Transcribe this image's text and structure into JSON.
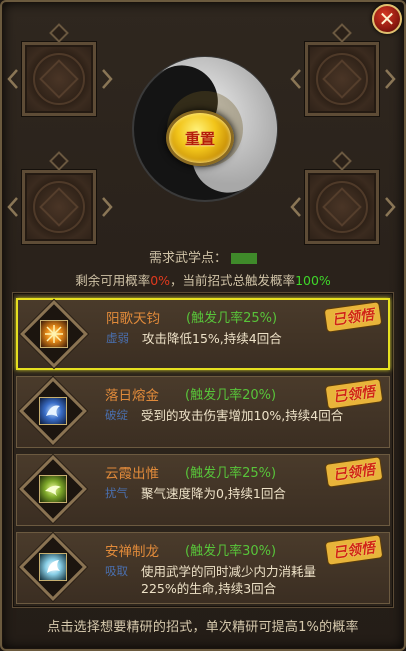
{
  "top": {
    "reset_label": "重置"
  },
  "requirement": {
    "label": "需求武学点："
  },
  "probability": {
    "prefix": "剩余可用概率",
    "remaining": "0%",
    "middle": "，当前招式总触发概率",
    "total": "100%"
  },
  "skills": [
    {
      "name": "阳歌天钧",
      "rate": "(触发几率25%)",
      "type": "虚弱",
      "desc": "攻击降低15%,持续4回合",
      "badge": "已领悟",
      "icon": "sun-burst-icon",
      "selected": true
    },
    {
      "name": "落日熔金",
      "rate": "(触发几率20%)",
      "type": "破绽",
      "desc": "受到的攻击伤害增加10%,持续4回合",
      "badge": "已领悟",
      "icon": "dragon-icon",
      "selected": false
    },
    {
      "name": "云霞出惟",
      "rate": "(触发几率25%)",
      "type": "扰气",
      "desc": "聚气速度降为0,持续1回合",
      "badge": "已领悟",
      "icon": "twin-dragon-icon",
      "selected": false
    },
    {
      "name": "安禅制龙",
      "rate": "(触发几率30%)",
      "type": "吸取",
      "desc": "使用武学的同时减少内力消耗量225%的生命,持续3回合",
      "badge": "已领悟",
      "icon": "white-dragon-icon",
      "selected": false
    }
  ],
  "footer": {
    "text": "点击选择想要精研的招式，单次精研可提高1%的概率"
  },
  "colors": {
    "accent_gold": "#e6e020",
    "name_orange": "#e08a3a",
    "rate_green": "#58c43a",
    "close_red": "#c02a18"
  }
}
